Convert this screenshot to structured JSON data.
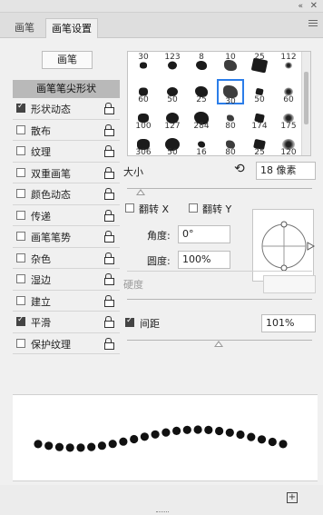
{
  "window": {
    "collapse_icon": "double-chevron-icon",
    "close_icon": "close-icon"
  },
  "tabs": [
    {
      "label": "画笔",
      "active": false
    },
    {
      "label": "画笔设置",
      "active": true
    }
  ],
  "brush_button": "画笔",
  "tip_shape_label": "画笔笔尖形状",
  "options": [
    {
      "label": "形状动态",
      "checked": true
    },
    {
      "label": "散布",
      "checked": false
    },
    {
      "label": "纹理",
      "checked": false
    },
    {
      "label": "双重画笔",
      "checked": false
    },
    {
      "label": "颜色动态",
      "checked": false
    },
    {
      "label": "传递",
      "checked": false
    },
    {
      "label": "画笔笔势",
      "checked": false
    },
    {
      "label": "杂色",
      "checked": false
    },
    {
      "label": "湿边",
      "checked": false
    },
    {
      "label": "建立",
      "checked": false
    },
    {
      "label": "平滑",
      "checked": true
    },
    {
      "label": "保护纹理",
      "checked": false
    }
  ],
  "presets": [
    [
      "30",
      "123",
      "8",
      "10",
      "25",
      "112"
    ],
    [
      "60",
      "50",
      "25",
      "30",
      "50",
      "60"
    ],
    [
      "100",
      "127",
      "284",
      "80",
      "174",
      "175"
    ],
    [
      "306",
      "50",
      "16",
      "80",
      "25",
      "120"
    ]
  ],
  "selected_preset": {
    "row": 1,
    "col": 3
  },
  "size": {
    "label": "大小",
    "value": "18 像素"
  },
  "flip_x": "翻转 X",
  "flip_y": "翻转 Y",
  "angle": {
    "label": "角度:",
    "value": "0°"
  },
  "roundness": {
    "label": "圆度:",
    "value": "100%"
  },
  "hardness_label": "硬度",
  "spacing": {
    "label": "间距",
    "value": "101%",
    "checked": true
  },
  "colors": {
    "selection": "#2b7de9",
    "header_bg": "#b9b9b9",
    "panel_bg": "#f0f0f0"
  }
}
